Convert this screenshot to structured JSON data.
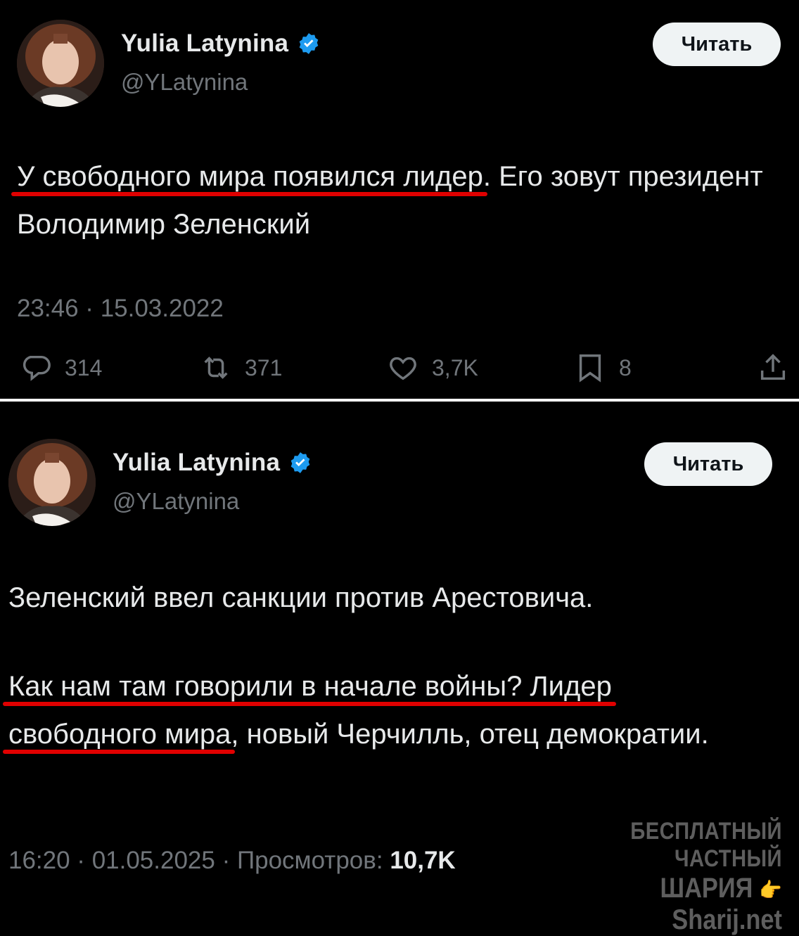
{
  "tweets": [
    {
      "author_name": "Yulia Latynina",
      "handle": "@YLatynina",
      "follow_label": "Читать",
      "text_underlined": "У свободного мира появился лидер",
      "text_rest": ". Его зовут президент Володимир Зеленский",
      "timestamp": "23:46 · 15.03.2022",
      "stats": {
        "replies": "314",
        "reposts": "371",
        "likes": "3,7K",
        "bookmarks": "8"
      }
    },
    {
      "author_name": "Yulia Latynina",
      "handle": "@YLatynina",
      "follow_label": "Читать",
      "paragraph1": "Зеленский ввел санкции против Арестовича.",
      "p2_underlined_1": "Как нам там говорили в начале войны? Лидер",
      "p2_underlined_2": "свободного мира",
      "p2_rest": ", новый Черчилль, отец демократии.",
      "timestamp": "16:20 · 01.05.2025 · Просмотров: ",
      "views": "10,7K"
    }
  ],
  "watermark": {
    "line1": "БЕСПЛАТНЫЙ ЧАСТНЫЙ",
    "brand": "ШАРИЯ",
    "site": "Sharij.net"
  },
  "colors": {
    "background": "#000000",
    "text": "#e7e9ea",
    "muted": "#71767b",
    "verified": "#1d9bf0",
    "underline": "#e00000"
  },
  "icons": [
    "verified-badge-icon",
    "reply-icon",
    "repost-icon",
    "like-icon",
    "bookmark-icon",
    "share-icon",
    "pointing-hand-icon"
  ]
}
